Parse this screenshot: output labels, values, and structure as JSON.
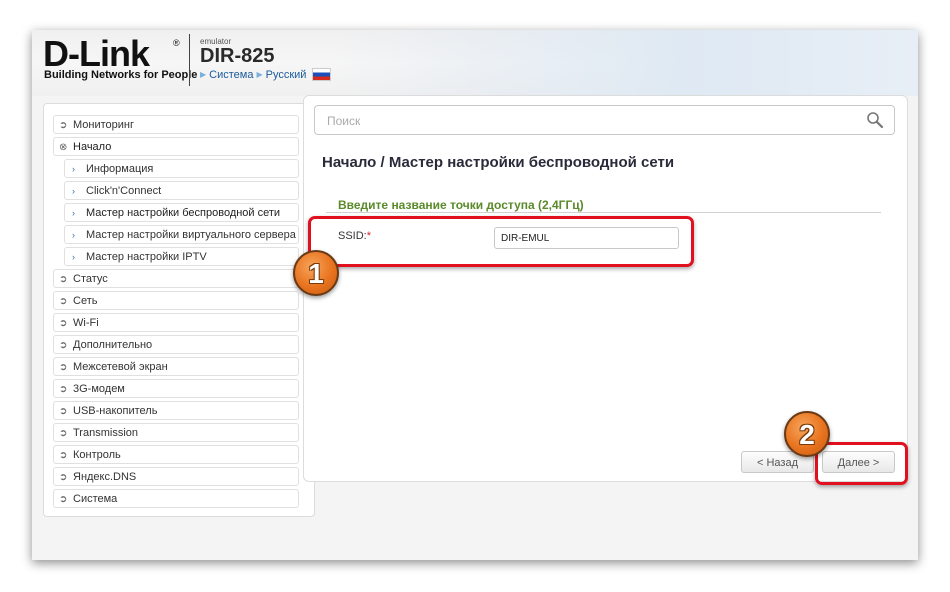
{
  "brand": {
    "logo": "D-Link",
    "reg": "®",
    "tagline": "Building Networks for People",
    "emulator": "emulator",
    "model": "DIR-825",
    "crumb_system": "Система",
    "crumb_language": "Русский"
  },
  "sidebar": {
    "items": [
      {
        "label": "Мониторинг",
        "icon": "chevron-right-circle-icon"
      },
      {
        "label": "Начало",
        "icon": "chevron-down-circle-icon"
      },
      {
        "label": "Информация",
        "icon": "chevron-right-icon"
      },
      {
        "label": "Click'n'Connect",
        "icon": "chevron-right-icon"
      },
      {
        "label": "Мастер настройки беспроводной сети",
        "icon": "chevron-right-icon"
      },
      {
        "label": "Мастер настройки виртуального сервера",
        "icon": "chevron-right-icon"
      },
      {
        "label": "Мастер настройки IPTV",
        "icon": "chevron-right-icon"
      },
      {
        "label": "Статус",
        "icon": "chevron-right-circle-icon"
      },
      {
        "label": "Сеть",
        "icon": "chevron-right-circle-icon"
      },
      {
        "label": "Wi-Fi",
        "icon": "chevron-right-circle-icon"
      },
      {
        "label": "Дополнительно",
        "icon": "chevron-right-circle-icon"
      },
      {
        "label": "Межсетевой экран",
        "icon": "chevron-right-circle-icon"
      },
      {
        "label": "3G-модем",
        "icon": "chevron-right-circle-icon"
      },
      {
        "label": "USB-накопитель",
        "icon": "chevron-right-circle-icon"
      },
      {
        "label": "Transmission",
        "icon": "chevron-right-circle-icon"
      },
      {
        "label": "Контроль",
        "icon": "chevron-right-circle-icon"
      },
      {
        "label": "Яндекс.DNS",
        "icon": "chevron-right-circle-icon"
      },
      {
        "label": "Система",
        "icon": "chevron-right-circle-icon"
      }
    ]
  },
  "main": {
    "search_placeholder": "Поиск",
    "title": "Начало /  Мастер настройки беспроводной сети",
    "section_title": "Введите название точки доступа (2,4ГГц)",
    "ssid_label": "SSID:",
    "ssid_required": "*",
    "ssid_value": "DIR-EMUL",
    "back_label": "< Назад",
    "next_label": "Далее >"
  },
  "annotations": {
    "badge1": "1",
    "badge2": "2",
    "highlight_color": "#e0101e",
    "badge_color": "#e8731f"
  }
}
